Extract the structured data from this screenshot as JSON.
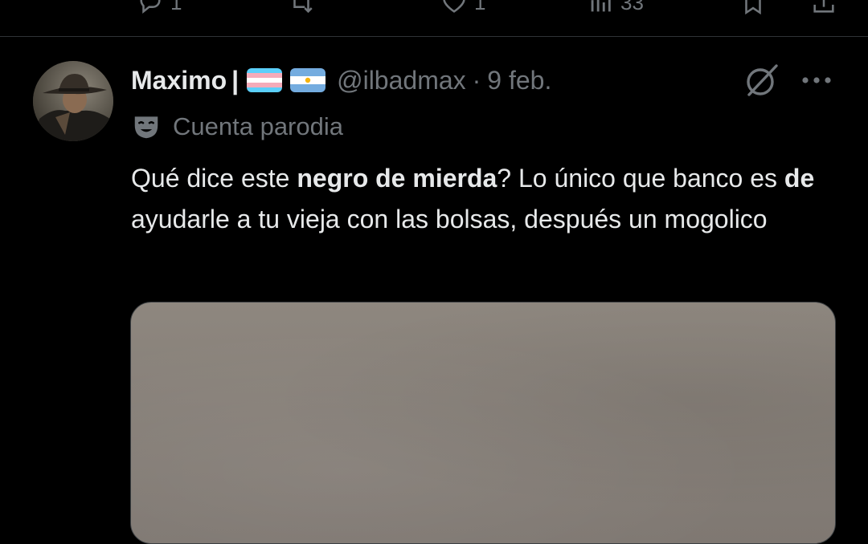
{
  "previous_tweet_actions": {
    "reply_count": "1",
    "repost_count": "",
    "like_count": "1",
    "views_count": "33"
  },
  "tweet": {
    "display_name": "Maximo",
    "separator": "|",
    "flags": [
      "transgender-flag",
      "argentina-flag"
    ],
    "handle": "@ilbadmax",
    "dot": "·",
    "date": "9 feb.",
    "parody_label": "Cuenta parodia",
    "text_segments": [
      {
        "text": "Qué dice este ",
        "bold": false
      },
      {
        "text": "negro de mierda",
        "bold": true
      },
      {
        "text": "? Lo único que banco es ",
        "bold": false
      },
      {
        "text": "de",
        "bold": true
      },
      {
        "text": " ayudarle a tu vieja con las bolsas, después un mogolico",
        "bold": false
      }
    ]
  },
  "icons": {
    "grok": "grok-icon",
    "more": "more-icon",
    "parody": "theater-mask-icon"
  },
  "colors": {
    "background": "#000000",
    "text_primary": "#e7e9ea",
    "text_secondary": "#71767b",
    "divider": "#2f3336"
  }
}
